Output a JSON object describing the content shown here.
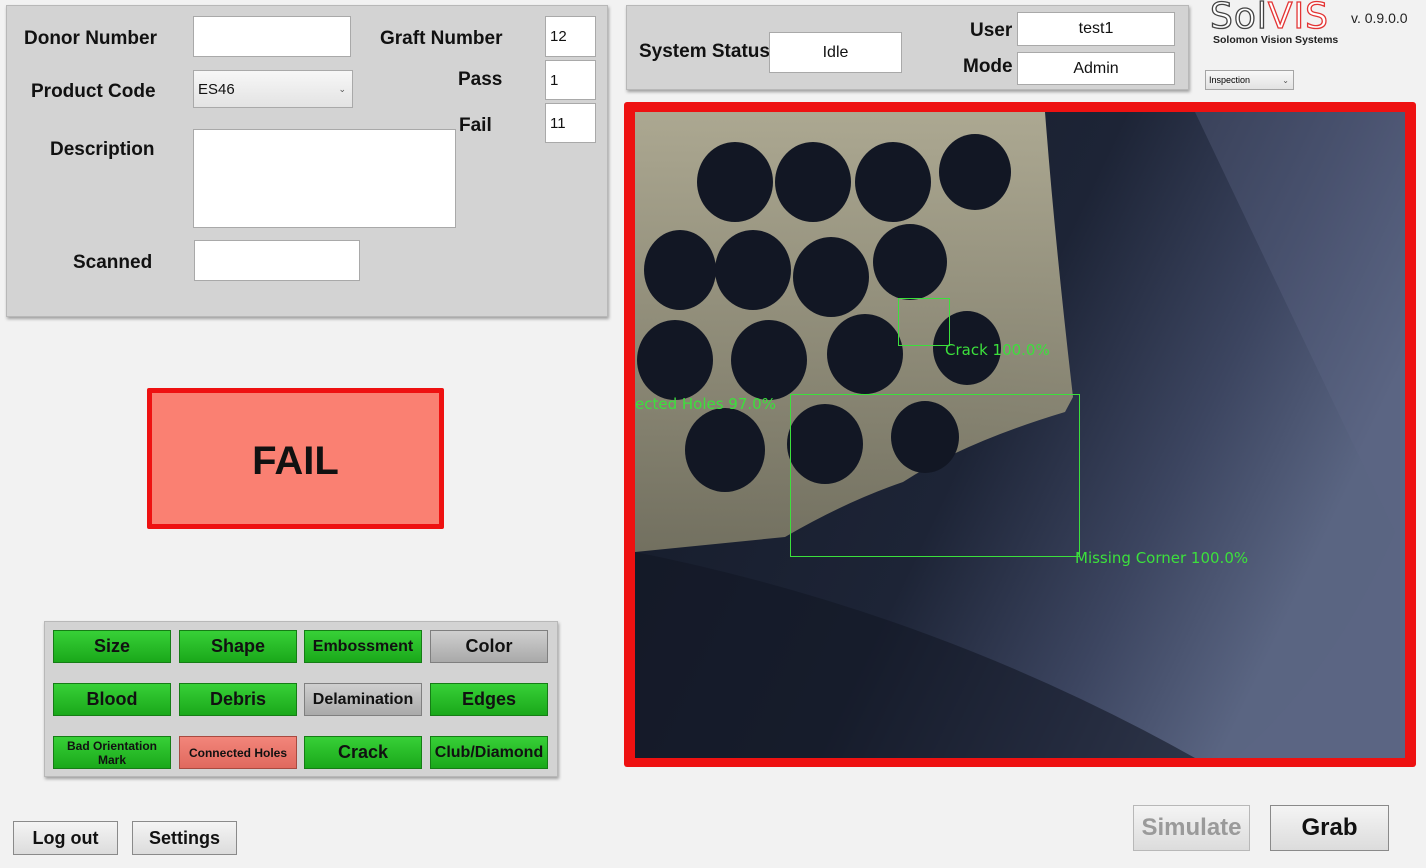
{
  "form": {
    "donor_number_label": "Donor Number",
    "donor_number_value": "",
    "graft_number_label": "Graft Number",
    "graft_number_value": "12",
    "product_code_label": "Product Code",
    "product_code_value": "ES46",
    "pass_label": "Pass",
    "pass_value": "1",
    "fail_label": "Fail",
    "fail_value": "11",
    "description_label": "Description",
    "description_value": "",
    "scanned_label": "Scanned",
    "scanned_value": ""
  },
  "status": {
    "system_status_label": "System Status",
    "system_status_value": "Idle",
    "user_label": "User",
    "user_value": "test1",
    "mode_label": "Mode",
    "mode_value": "Admin"
  },
  "brand": {
    "logo_text_sol": "Sol",
    "logo_text_vis": "VIS",
    "tagline": "Solomon Vision Systems",
    "version": "v. 0.9.0.0",
    "mode_select_value": "Inspection",
    "accent_color": "#e33434"
  },
  "result": {
    "label": "FAIL",
    "color": "#fa8072",
    "border_color": "#ee1111"
  },
  "inspections": [
    {
      "label": "Size",
      "state": "pass"
    },
    {
      "label": "Shape",
      "state": "pass"
    },
    {
      "label": "Embossment",
      "state": "pass"
    },
    {
      "label": "Color",
      "state": "disabled"
    },
    {
      "label": "Blood",
      "state": "pass"
    },
    {
      "label": "Debris",
      "state": "pass"
    },
    {
      "label": "Delamination",
      "state": "disabled"
    },
    {
      "label": "Edges",
      "state": "pass"
    },
    {
      "label": "Bad Orientation Mark",
      "state": "pass"
    },
    {
      "label": "Connected Holes",
      "state": "fail"
    },
    {
      "label": "Crack",
      "state": "pass"
    },
    {
      "label": "Club/Diamond",
      "state": "pass"
    }
  ],
  "image_view": {
    "detections": [
      {
        "label": "Crack 100.0%"
      },
      {
        "label": "ected Holes 97.0%"
      },
      {
        "label": "Missing Corner 100.0%"
      }
    ],
    "border_color": "#ee1111"
  },
  "buttons": {
    "logout_label": "Log out",
    "settings_label": "Settings",
    "simulate_label": "Simulate",
    "grab_label": "Grab"
  }
}
